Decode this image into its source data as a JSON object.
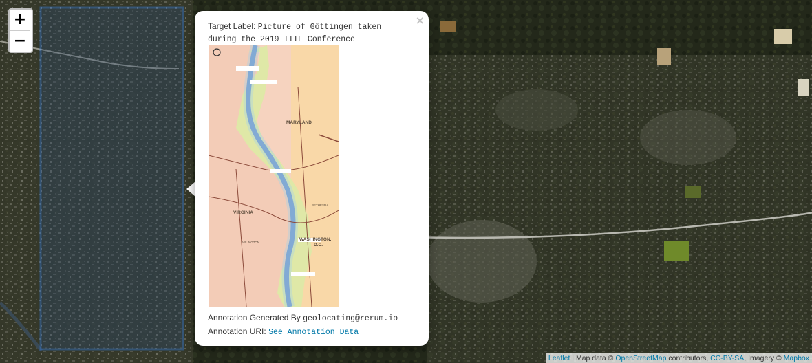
{
  "zoom": {
    "in_label": "+",
    "out_label": "−"
  },
  "popup": {
    "close_label": "×",
    "target_label_key": "Target Label:",
    "target_label_value": "Picture of Göttingen taken during the 2019 IIIF Conference",
    "generated_by_key": "Annotation Generated By",
    "generated_by_value": "geolocating@rerum.io",
    "uri_key": "Annotation URI:",
    "uri_link": "See Annotation Data",
    "map_labels": {
      "maryland": "MARYLAND",
      "virginia": "VIRGINIA",
      "washington_line1": "WASHINGTON,",
      "washington_line2": "D.C.",
      "bethesda": "BETHESDA",
      "arlington": "ARLINGTON"
    }
  },
  "attribution": {
    "leaflet": "Leaflet",
    "sep": " | Map data © ",
    "osm": "OpenStreetMap",
    "contributors": " contributors, ",
    "license": "CC-BY-SA",
    "imagery": ", Imagery © ",
    "mapbox": "Mapbox"
  },
  "colors": {
    "selection_border": "#3388ff",
    "link": "#0078a8",
    "map_river": "#6b8fc9",
    "map_land": "#f6d3bf",
    "map_park": "#d9c96a"
  }
}
